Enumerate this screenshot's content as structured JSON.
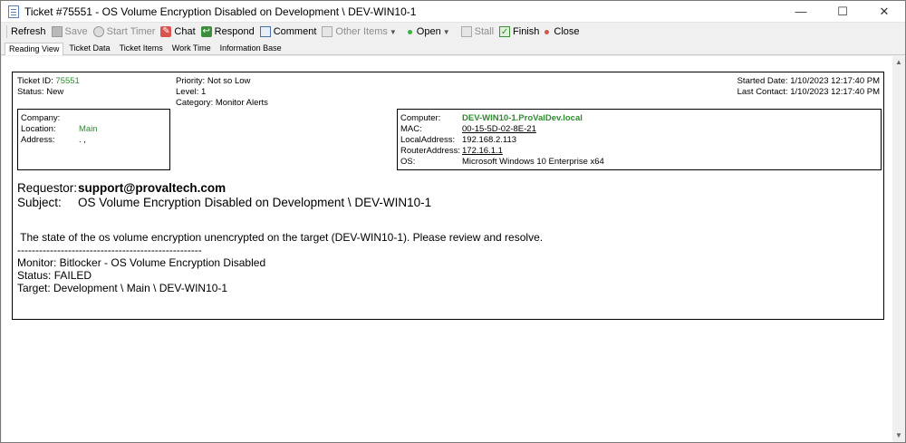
{
  "window": {
    "title": "Ticket #75551 - OS Volume Encryption Disabled  on Development \\ DEV-WIN10-1",
    "minimize": "—",
    "maximize": "☐",
    "close": "✕"
  },
  "toolbar": {
    "refresh": "Refresh",
    "save": "Save",
    "start_timer": "Start Timer",
    "chat": "Chat",
    "respond": "Respond",
    "comment": "Comment",
    "other_items": "Other Items",
    "open": "Open",
    "stall": "Stall",
    "finish": "Finish",
    "close": "Close"
  },
  "tabs": [
    "Reading View",
    "Ticket Data",
    "Ticket Items",
    "Work Time",
    "Information Base"
  ],
  "ticket": {
    "id_label": "Ticket ID:",
    "id": "75551",
    "status_label": "Status:",
    "status": "New",
    "priority_label": "Priority:",
    "priority": "Not so Low",
    "level_label": "Level:",
    "level": "1",
    "category_label": "Category:",
    "category": "Monitor Alerts",
    "started_label": "Started Date:",
    "started": "1/10/2023 12:17:40 PM",
    "last_contact_label": "Last Contact:",
    "last_contact": "1/10/2023 12:17:40 PM"
  },
  "company": {
    "company_label": "Company:",
    "company": "",
    "location_label": "Location:",
    "location": "Main",
    "address_label": "Address:",
    "address": ". ,"
  },
  "computer": {
    "computer_label": "Computer:",
    "computer": "DEV-WIN10-1.ProValDev.local",
    "mac_label": "MAC:",
    "mac": "00-15-5D-02-8E-21",
    "local_label": "LocalAddress:",
    "local": "192.168.2.113",
    "router_label": "RouterAddress:",
    "router": "172.16.1.1",
    "os_label": "OS:",
    "os": "Microsoft Windows 10 Enterprise x64"
  },
  "message": {
    "requestor_label": "Requestor:",
    "requestor": "support@provaltech.com",
    "subject_label": "Subject:",
    "subject": "OS Volume Encryption Disabled on Development \\ DEV-WIN10-1",
    "body": " The state of the os volume encryption unencrypted on the target (DEV-WIN10-1). Please review and resolve.\n---------------------------------------------------\nMonitor: Bitlocker - OS Volume Encryption Disabled\nStatus: FAILED\nTarget: Development \\ Main \\ DEV-WIN10-1"
  }
}
